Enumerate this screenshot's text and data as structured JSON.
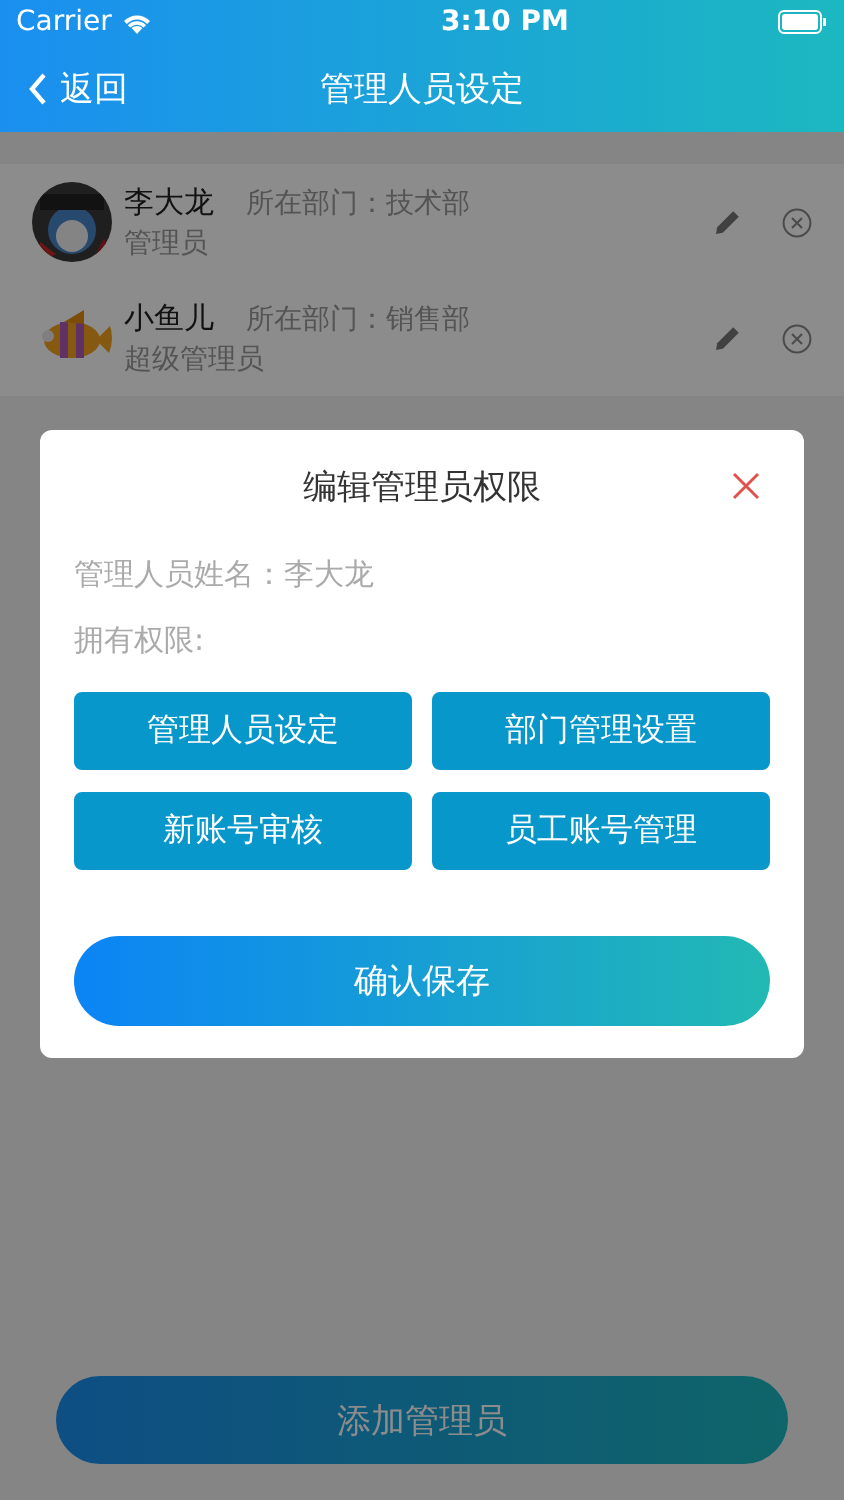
{
  "status_bar": {
    "carrier": "Carrier",
    "time": "3:10 PM"
  },
  "nav_bar": {
    "back": "返回",
    "title": "管理人员设定"
  },
  "admins": [
    {
      "name": "李大龙",
      "department": "所在部门：技术部",
      "role": "管理员"
    },
    {
      "name": "小鱼儿",
      "department": "所在部门：销售部",
      "role": "超级管理员"
    }
  ],
  "dialog": {
    "title": "编辑管理员权限",
    "name_line": "管理人员姓名：李大龙",
    "permissions_label": "拥有权限:",
    "permissions": [
      {
        "label": "管理人员设定",
        "selected": true
      },
      {
        "label": "部门管理设置",
        "selected": true
      },
      {
        "label": "新账号审核",
        "selected": true
      },
      {
        "label": "员工账号管理",
        "selected": true
      }
    ],
    "confirm": "确认保存"
  },
  "add_button": "添加管理员"
}
